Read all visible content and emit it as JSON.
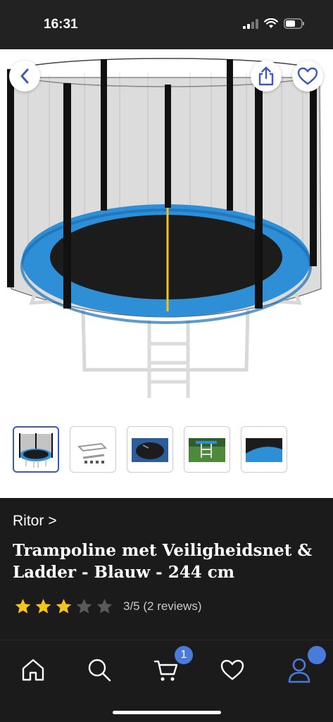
{
  "status": {
    "time": "16:31",
    "icons": [
      "cellular-signal-icon",
      "wifi-icon",
      "battery-icon"
    ]
  },
  "top_actions": {
    "back_icon": "chevron-left-icon",
    "share_icon": "share-icon",
    "favorite_icon": "heart-icon"
  },
  "gallery": {
    "thumbnails": [
      {
        "name": "trampoline-full-view",
        "active": true
      },
      {
        "name": "ladder-parts",
        "active": false
      },
      {
        "name": "mat-closeup",
        "active": false
      },
      {
        "name": "trampoline-in-garden",
        "active": false
      },
      {
        "name": "padding-closeup",
        "active": false
      }
    ]
  },
  "product": {
    "brand": "Ritor",
    "brand_chevron": ">",
    "title": "Trampoline met Veiligheidsnet & Ladder - Blauw - 244 cm",
    "rating": {
      "stars_filled": 3,
      "stars_total": 5,
      "text": "3/5 (2 reviews)"
    }
  },
  "colors": {
    "accent_blue": "#4a7bd8",
    "star_gold": "#f5c518",
    "star_empty": "#5a5a5a",
    "trampoline_blue": "#2f8fd6"
  },
  "nav": {
    "items": [
      "home-icon",
      "search-icon",
      "cart-icon",
      "heart-icon",
      "account-icon"
    ],
    "cart_badge": "1"
  }
}
